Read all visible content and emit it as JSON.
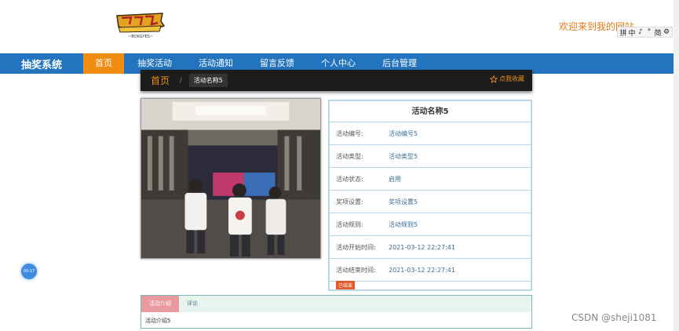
{
  "header": {
    "welcome": "欢迎来到我的网站",
    "ime": [
      "拼",
      "中",
      "♪",
      "°",
      "简",
      "⚙"
    ]
  },
  "nav": {
    "brand": "抽奖系统",
    "items": [
      {
        "label": "首页",
        "active": true
      },
      {
        "label": "抽奖活动",
        "active": false
      },
      {
        "label": "活动通知",
        "active": false
      },
      {
        "label": "留言反馈",
        "active": false
      },
      {
        "label": "个人中心",
        "active": false
      },
      {
        "label": "后台管理",
        "active": false
      }
    ]
  },
  "breadcrumb": {
    "home": "首页",
    "separator": "/",
    "current": "活动名称5",
    "favorite": "点我收藏"
  },
  "detail": {
    "title": "活动名称5",
    "rows": [
      {
        "key": "活动编号:",
        "value": "活动编号5"
      },
      {
        "key": "活动类型:",
        "value": "活动类型5"
      },
      {
        "key": "活动状态:",
        "value": "启用"
      },
      {
        "key": "奖项设置:",
        "value": "奖项设置5"
      },
      {
        "key": "活动规则:",
        "value": "活动规则5"
      },
      {
        "key": "活动开始时间:",
        "value": "2021-03-12 22:27:41"
      },
      {
        "key": "活动结束时间:",
        "value": "2021-03-12 22:27:41"
      }
    ],
    "status_tag": "已结束"
  },
  "tabs": {
    "items": [
      {
        "label": "活动介绍",
        "active": true
      },
      {
        "label": "评论",
        "active": false
      }
    ],
    "content": "活动介绍5"
  },
  "timer": "00:17",
  "watermark": "CSDN @sheji1081",
  "colors": {
    "nav_bg": "#2374be",
    "nav_active": "#f08c12",
    "accent_orange": "#e07a16",
    "panel_border": "#b8d8e6"
  }
}
